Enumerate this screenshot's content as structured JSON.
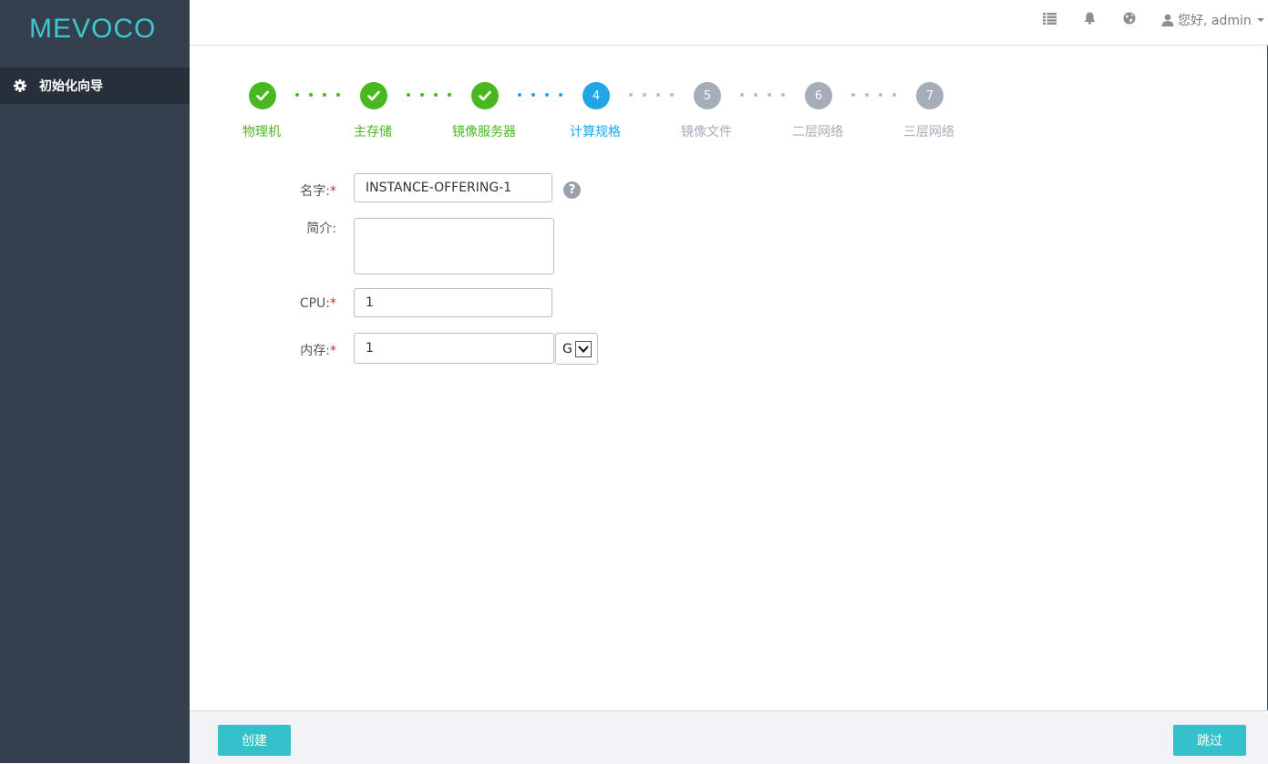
{
  "brand": {
    "logo_text": "MEVOCO"
  },
  "sidebar": {
    "items": [
      {
        "label": "初始化向导",
        "icon": "gear-icon"
      }
    ]
  },
  "topbar": {
    "icons": [
      "list-icon",
      "bell-icon",
      "globe-icon",
      "user-icon"
    ],
    "user_greeting": "您好, admin"
  },
  "wizard": {
    "current_step": 4,
    "steps": [
      {
        "number": "1",
        "label": "物理机",
        "state": "done"
      },
      {
        "number": "2",
        "label": "主存储",
        "state": "done"
      },
      {
        "number": "3",
        "label": "镜像服务器",
        "state": "done"
      },
      {
        "number": "4",
        "label": "计算规格",
        "state": "active"
      },
      {
        "number": "5",
        "label": "镜像文件",
        "state": "todo"
      },
      {
        "number": "6",
        "label": "二层网络",
        "state": "todo"
      },
      {
        "number": "7",
        "label": "三层网络",
        "state": "todo"
      }
    ]
  },
  "form": {
    "name": {
      "label": "名字:",
      "required_mark": "*",
      "value": "INSTANCE-OFFERING-1",
      "help_icon": "question-icon"
    },
    "description": {
      "label": "简介:",
      "value": ""
    },
    "cpu": {
      "label": "CPU:",
      "required_mark": "*",
      "value": "1"
    },
    "memory": {
      "label": "内存:",
      "required_mark": "*",
      "value": "1",
      "unit": "G"
    }
  },
  "footer": {
    "create_label": "创建",
    "skip_label": "跳过"
  },
  "colors": {
    "sidebar": "#35404f",
    "done": "#49b820",
    "active": "#21a5e6",
    "todo": "#a5adb8",
    "button": "#35c1cb"
  }
}
